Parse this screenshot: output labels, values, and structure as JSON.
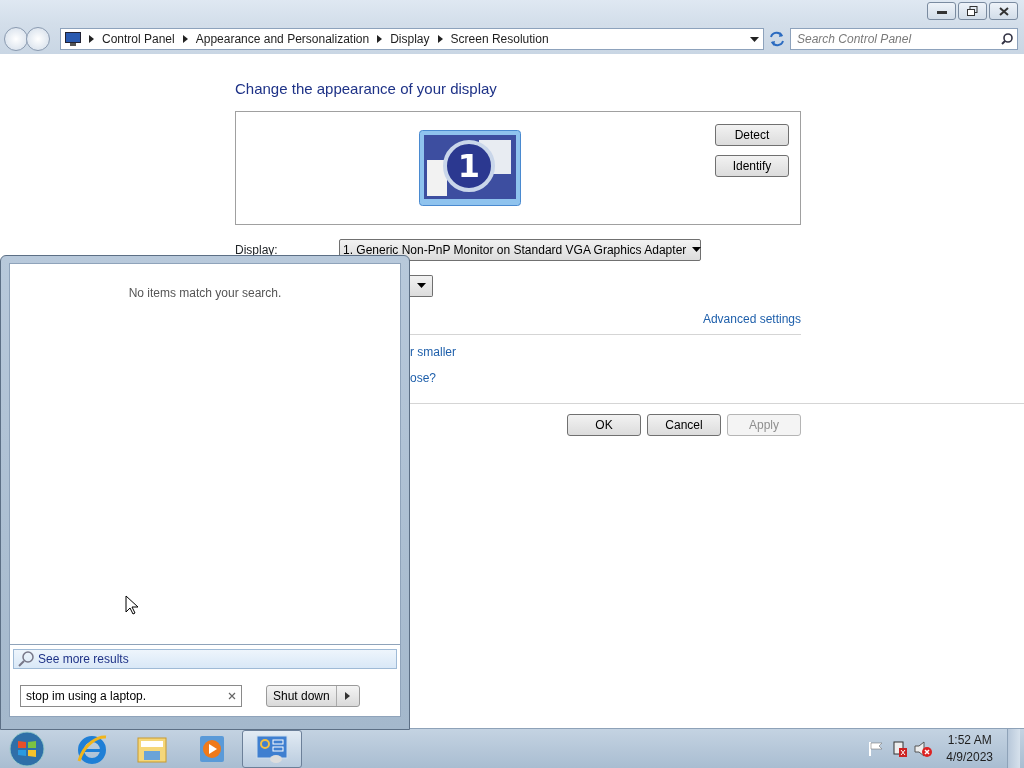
{
  "address_bar": {
    "breadcrumb": [
      "Control Panel",
      "Appearance and Personalization",
      "Display",
      "Screen Resolution"
    ],
    "search": {
      "placeholder": "Search Control Panel"
    }
  },
  "content": {
    "heading": "Change the appearance of your display",
    "monitor_number": "1",
    "side_buttons": [
      "Detect",
      "Identify"
    ],
    "display": {
      "label": "Display:",
      "value": "1. Generic Non-PnP Monitor on Standard VGA Graphics Adapter"
    },
    "advanced_link": "Advanced settings",
    "cut_links": [
      "r smaller",
      "ose?"
    ],
    "dialog_buttons": [
      {
        "label": "OK",
        "disabled": false
      },
      {
        "label": "Cancel",
        "disabled": false
      },
      {
        "label": "Apply",
        "disabled": true
      }
    ]
  },
  "start_menu": {
    "message": "No items match your search.",
    "see_more": "See more results",
    "search": {
      "value": "stop im using a laptop."
    },
    "shutdown": "Shut down"
  },
  "taskbar": {
    "apps": [
      {
        "kind": "browser",
        "selected": false
      },
      {
        "kind": "folder",
        "selected": false
      },
      {
        "kind": "media",
        "selected": false
      },
      {
        "kind": "control-panel",
        "selected": true
      }
    ],
    "clock": {
      "time": "1:52 AM",
      "date": "4/9/2023"
    }
  }
}
